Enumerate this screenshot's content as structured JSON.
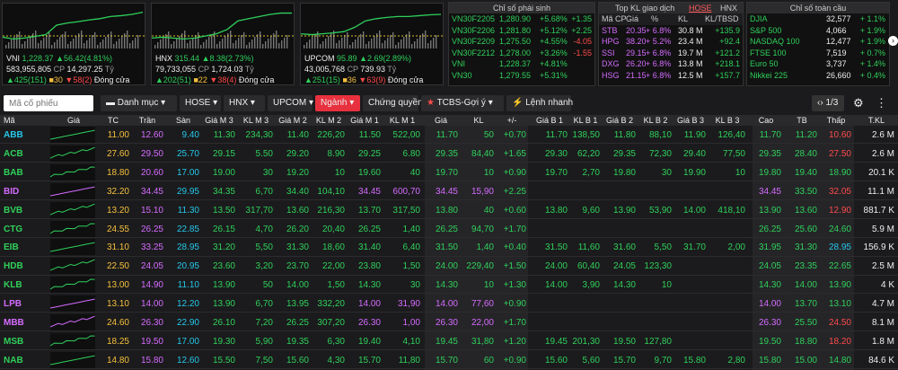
{
  "indices": [
    {
      "name": "VNI",
      "value": "1,228.37",
      "change": "▲56.42(4.81%)",
      "volume": "583,955,805",
      "vol_unit": "CP",
      "amount": "14,297.25",
      "amt_unit": "Tỷ",
      "up": "▲425(151)",
      "flat": "30",
      "down": "▼58(2)",
      "status": "Đóng cửa"
    },
    {
      "name": "HNX",
      "value": "315.44",
      "change": "▲8.38(2.73%)",
      "volume": "79,733,055",
      "vol_unit": "CP",
      "amount": "1,724.03",
      "amt_unit": "Tỷ",
      "up": "▲202(51)",
      "flat": "22",
      "down": "▼38(4)",
      "status": "Đóng cửa"
    },
    {
      "name": "UPCOM",
      "value": "95.89",
      "change": "▲2.69(2.89%)",
      "volume": "43,005,768",
      "vol_unit": "CP",
      "amount": "739.93",
      "amt_unit": "Tỷ",
      "up": "▲251(15)",
      "flat": "36",
      "down": "▼63(9)",
      "status": "Đóng cửa"
    }
  ],
  "derivatives": {
    "title": "Chỉ số phái sinh",
    "rows": [
      [
        "VN30F2205",
        "1,280.90",
        "+5.68%",
        "+1.35"
      ],
      [
        "VN30F2206",
        "1,281.80",
        "+5.12%",
        "+2.25"
      ],
      [
        "VN30F2209",
        "1,275.50",
        "+4.55%",
        "-4.05"
      ],
      [
        "VN30F2212",
        "1,278.00",
        "+3.26%",
        "-1.55"
      ],
      [
        "VNI",
        "1,228.37",
        "+4.81%",
        ""
      ],
      [
        "VN30",
        "1,279.55",
        "+5.31%",
        ""
      ]
    ]
  },
  "topkl": {
    "title": "Top KL giao dịch",
    "tab1": "HOSE",
    "tab2": "HNX",
    "cols": [
      "Mã CP",
      "Giá",
      "%",
      "KL",
      "KL/TBSD"
    ],
    "rows": [
      [
        "STB",
        "20.35",
        "+ 6.8%",
        "30.8 M",
        "+135.9"
      ],
      [
        "HPG",
        "38.20",
        "+ 5.2%",
        "23.4 M",
        "+92.4"
      ],
      [
        "SSI",
        "29.15",
        "+ 6.8%",
        "19.7 M",
        "+121.2"
      ],
      [
        "DXG",
        "26.20",
        "+ 6.8%",
        "13.8 M",
        "+218.1"
      ],
      [
        "HSG",
        "21.15",
        "+ 6.8%",
        "12.5 M",
        "+157.7"
      ]
    ]
  },
  "world": {
    "title": "Chỉ số toàn cầu",
    "rows": [
      [
        "DJIA",
        "32,577",
        "+ 1.1%"
      ],
      [
        "S&P 500",
        "4,066",
        "+ 1.9%"
      ],
      [
        "NASDAQ 100",
        "12,477",
        "+ 1.9%"
      ],
      [
        "FTSE 100",
        "7,519",
        "+ 0.7%"
      ],
      [
        "Euro 50",
        "3,737",
        "+ 1.4%"
      ],
      [
        "Nikkei 225",
        "26,660",
        "+ 0.4%"
      ]
    ]
  },
  "toolbar": {
    "search_placeholder": "Mã cổ phiếu",
    "danhmuc": "Danh mục",
    "hose": "HOSE",
    "hnx": "HNX",
    "upcom": "UPCOM",
    "nganh": "Ngành",
    "chungquyen": "Chứng quyền",
    "tcbs": "TCBS-Gợi ý",
    "lenhnhanh": "Lệnh nhanh",
    "page": "1/3"
  },
  "columns": [
    "Mã",
    "Giá",
    "TC",
    "Trần",
    "Sàn",
    "Giá M 3",
    "KL M 3",
    "Giá M 2",
    "KL M 2",
    "Giá M 1",
    "KL M 1",
    "Giá",
    "KL",
    "+/-",
    "Giá B 1",
    "KL B 1",
    "Giá B 2",
    "KL B 2",
    "Giá B 3",
    "KL B 3",
    "Cao",
    "TB",
    "Thấp",
    "T.KL"
  ],
  "rows": [
    {
      "sym": "ABB",
      "c": "c",
      "v": [
        "11.00",
        "12.60",
        "9.40",
        "11.30",
        "234,30",
        "11.40",
        "226,20",
        "11.50",
        "522,00",
        "11.70",
        "50",
        "+0.70",
        "11.70",
        "138,50",
        "11.80",
        "88,10",
        "11.90",
        "126,40",
        "11.70",
        "11.20",
        "10.60",
        "2.6 M"
      ]
    },
    {
      "sym": "ACB",
      "c": "g",
      "v": [
        "27.60",
        "29.50",
        "25.70",
        "29.15",
        "5.50",
        "29.20",
        "8.90",
        "29.25",
        "6.80",
        "29.35",
        "84,40",
        "+1.65",
        "29.30",
        "62,20",
        "29.35",
        "72,30",
        "29.40",
        "77,50",
        "29.35",
        "28.40",
        "27.50",
        "2.6 M"
      ]
    },
    {
      "sym": "BAB",
      "c": "g",
      "v": [
        "18.80",
        "20.60",
        "17.00",
        "19.00",
        "30",
        "19.20",
        "10",
        "19.60",
        "40",
        "19.70",
        "10",
        "+0.90",
        "19.70",
        "2,70",
        "19.80",
        "30",
        "19.90",
        "10",
        "19.80",
        "19.40",
        "18.90",
        "20.1 K"
      ]
    },
    {
      "sym": "BID",
      "c": "p",
      "v": [
        "32.20",
        "34.45",
        "29.95",
        "34.35",
        "6,70",
        "34.40",
        "104,10",
        "34.45",
        "600,70",
        "34.45",
        "15,90",
        "+2.25",
        "",
        "",
        "",
        "",
        "",
        "",
        "34.45",
        "33.50",
        "32.05",
        "11.1 M"
      ]
    },
    {
      "sym": "BVB",
      "c": "g",
      "v": [
        "13.20",
        "15.10",
        "11.30",
        "13.50",
        "317,70",
        "13.60",
        "216,30",
        "13.70",
        "317,50",
        "13.80",
        "40",
        "+0.60",
        "13.80",
        "9,60",
        "13.90",
        "53,90",
        "14.00",
        "418,10",
        "13.90",
        "13.60",
        "12.90",
        "881.7 K"
      ]
    },
    {
      "sym": "CTG",
      "c": "g",
      "v": [
        "24.55",
        "26.25",
        "22.85",
        "26.15",
        "4,70",
        "26.20",
        "20,40",
        "26.25",
        "1,40",
        "26.25",
        "94,70",
        "+1.70",
        "",
        "",
        "",
        "",
        "",
        "",
        "26.25",
        "25.60",
        "24.60",
        "5.9 M"
      ]
    },
    {
      "sym": "EIB",
      "c": "g",
      "v": [
        "31.10",
        "33.25",
        "28.95",
        "31.20",
        "5,50",
        "31.30",
        "18,60",
        "31.40",
        "6,40",
        "31.50",
        "1,40",
        "+0.40",
        "31.50",
        "11,60",
        "31.60",
        "5,50",
        "31.70",
        "2,00",
        "31.95",
        "31.30",
        "28.95",
        "156.9 K"
      ]
    },
    {
      "sym": "HDB",
      "c": "g",
      "v": [
        "22.50",
        "24.05",
        "20.95",
        "23.60",
        "3,20",
        "23.70",
        "22,00",
        "23.80",
        "1,50",
        "24.00",
        "229,40",
        "+1.50",
        "24.00",
        "60,40",
        "24.05",
        "123,30",
        "",
        "",
        "24.05",
        "23.35",
        "22.65",
        "2.5 M"
      ]
    },
    {
      "sym": "KLB",
      "c": "g",
      "v": [
        "13.00",
        "14.90",
        "11.10",
        "13.90",
        "50",
        "14.00",
        "1,50",
        "14.30",
        "30",
        "14.30",
        "10",
        "+1.30",
        "14.00",
        "3,90",
        "14.30",
        "10",
        "",
        "",
        "14.30",
        "14.00",
        "13.90",
        "4 K"
      ]
    },
    {
      "sym": "LPB",
      "c": "p",
      "v": [
        "13.10",
        "14.00",
        "12.20",
        "13.90",
        "6,70",
        "13.95",
        "332,20",
        "14.00",
        "31,90",
        "14.00",
        "77,60",
        "+0.90",
        "",
        "",
        "",
        "",
        "",
        "",
        "14.00",
        "13.70",
        "13.10",
        "4.7 M"
      ]
    },
    {
      "sym": "MBB",
      "c": "p",
      "v": [
        "24.60",
        "26.30",
        "22.90",
        "26.10",
        "7,20",
        "26.25",
        "307,20",
        "26.30",
        "1,00",
        "26.30",
        "22,00",
        "+1.70",
        "",
        "",
        "",
        "",
        "",
        "",
        "26.30",
        "25.50",
        "24.50",
        "8.1 M"
      ]
    },
    {
      "sym": "MSB",
      "c": "g",
      "v": [
        "18.25",
        "19.50",
        "17.00",
        "19.30",
        "5,90",
        "19.35",
        "6,30",
        "19.40",
        "4,10",
        "19.45",
        "31,80",
        "+1.20",
        "19.45",
        "201,30",
        "19.50",
        "127,80",
        "",
        "",
        "19.50",
        "18.80",
        "18.20",
        "1.8 M"
      ]
    },
    {
      "sym": "NAB",
      "c": "g",
      "v": [
        "14.80",
        "15.80",
        "12.60",
        "15.50",
        "7,50",
        "15.60",
        "4,30",
        "15.70",
        "11,80",
        "15.70",
        "60",
        "+0.90",
        "15.60",
        "5,60",
        "15.70",
        "9,70",
        "15.80",
        "2,80",
        "15.80",
        "15.00",
        "14.80",
        "84.6 K"
      ]
    }
  ]
}
